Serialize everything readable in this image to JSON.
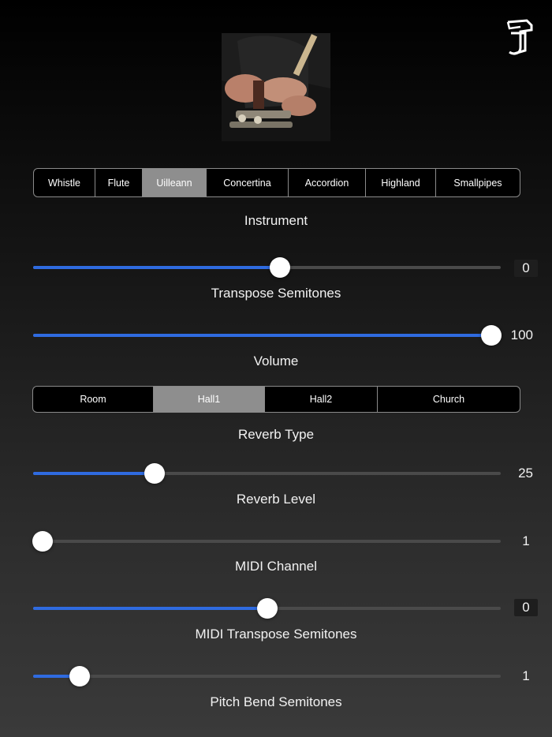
{
  "header": {
    "logo_icon": "stylized-letter-logo-icon"
  },
  "photo": {
    "subject": "uilleann-pipes-player-image"
  },
  "instrument": {
    "options": [
      "Whistle",
      "Flute",
      "Uilleann",
      "Concertina",
      "Accordion",
      "Highland",
      "Smallpipes"
    ],
    "selected_index": 2,
    "caption": "Instrument"
  },
  "transpose": {
    "label": "Transpose Semitones",
    "value": "0",
    "fraction": 0.527
  },
  "volume": {
    "label": "Volume",
    "value": "100",
    "fraction": 0.98
  },
  "reverb": {
    "options": [
      "Room",
      "Hall1",
      "Hall2",
      "Church"
    ],
    "selected_index": 1,
    "caption": "Reverb Type"
  },
  "reverb_level": {
    "label": "Reverb Level",
    "value": "25",
    "fraction": 0.26
  },
  "midi_channel": {
    "label": "MIDI Channel",
    "value": "1",
    "fraction": 0.02
  },
  "midi_transpose": {
    "label": "MIDI Transpose Semitones",
    "value": "0",
    "fraction": 0.5
  },
  "pitch_bend": {
    "label": "Pitch Bend Semitones",
    "value": "1",
    "fraction": 0.1
  },
  "colors": {
    "accent": "#2f6be0",
    "selected_segment": "#8e8e8e",
    "track": "#4a4a4a"
  }
}
